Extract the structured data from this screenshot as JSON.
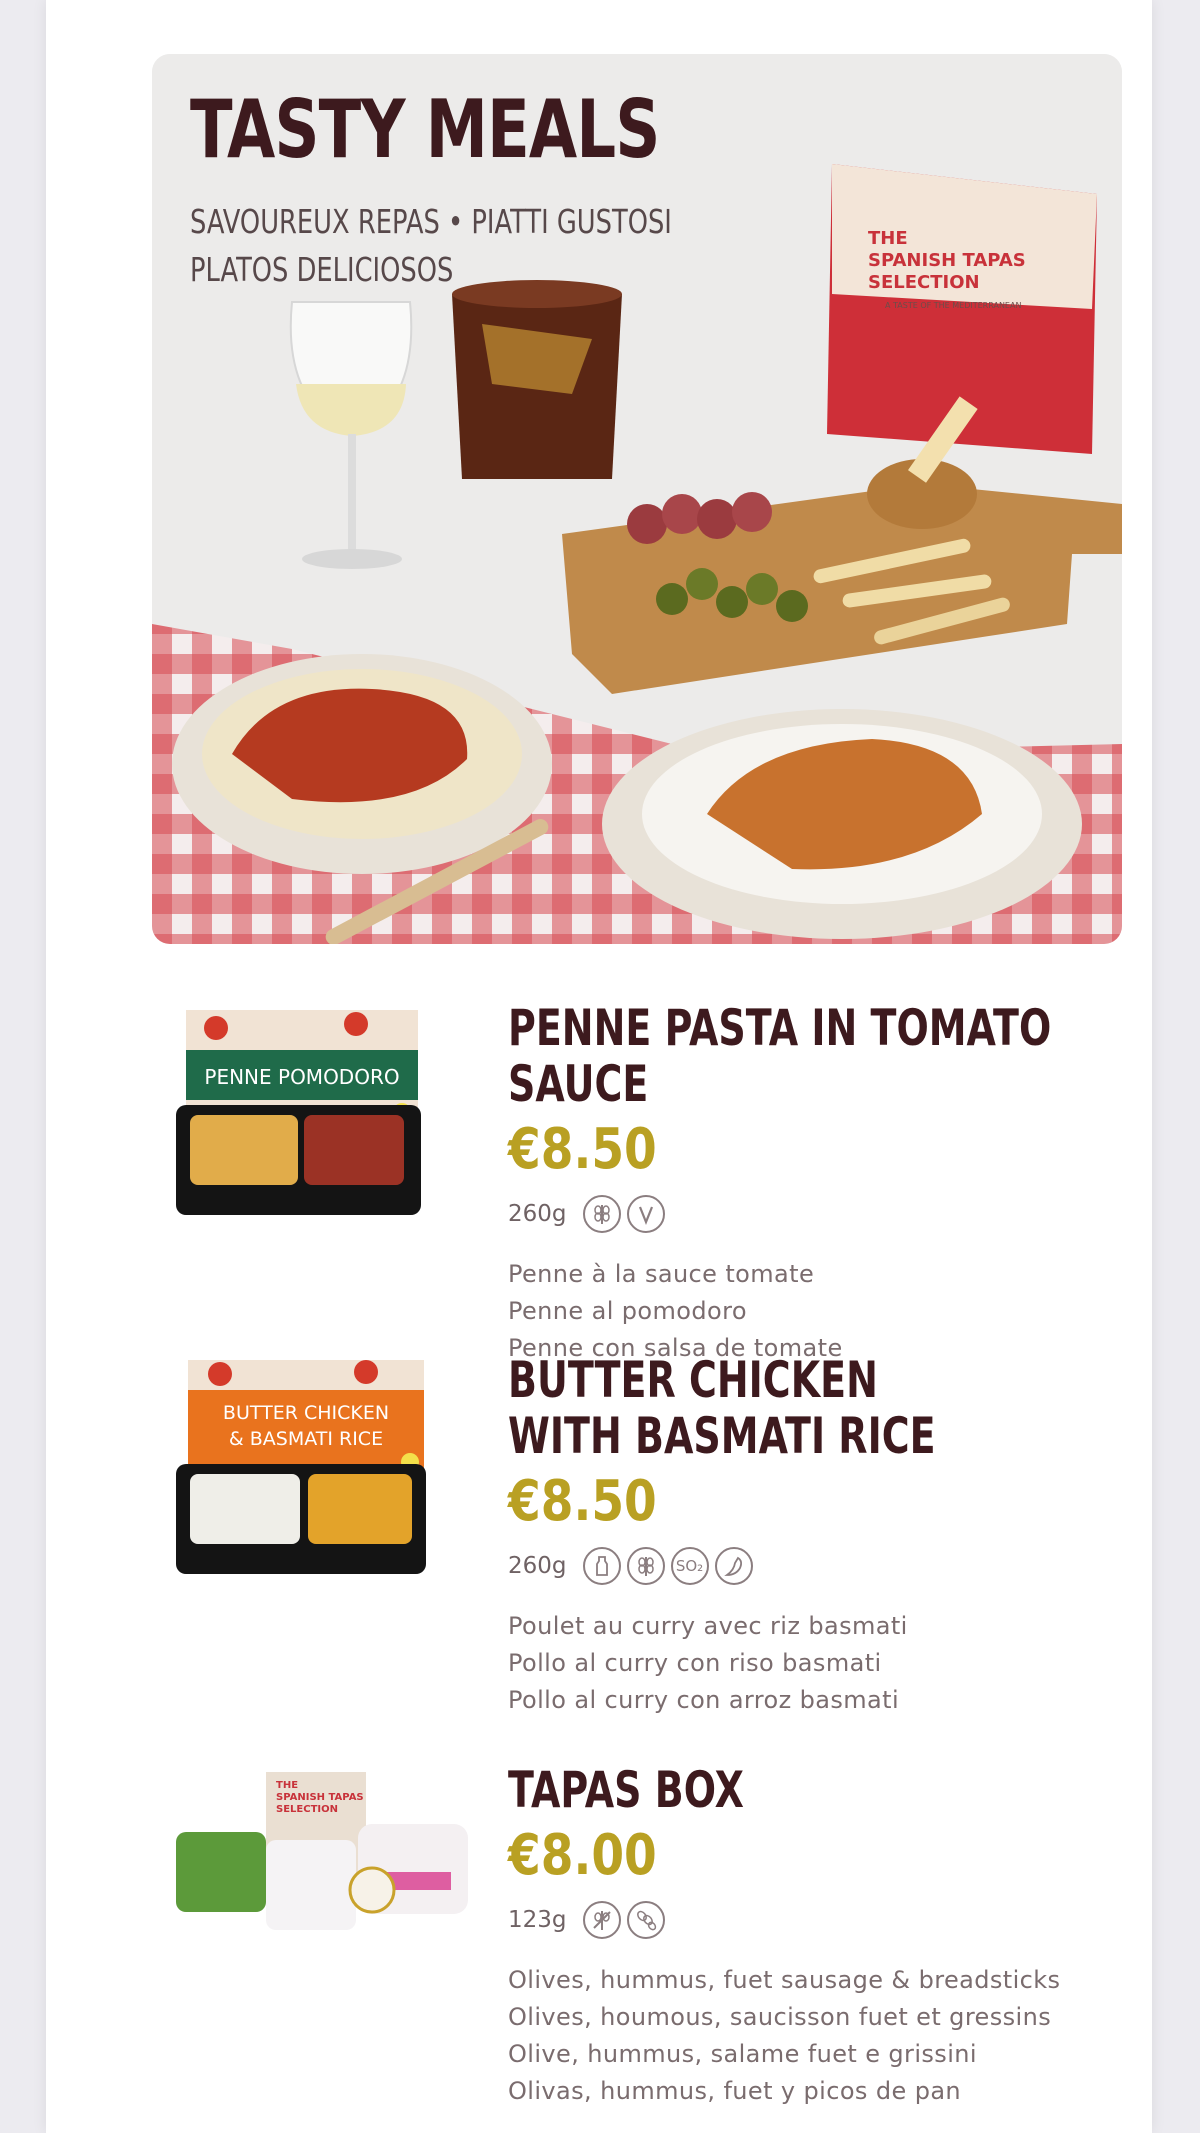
{
  "hero": {
    "title": "TASTY MEALS",
    "subtitle_line1": "SAVOUREUX REPAS • PIATTI GUSTOSI",
    "subtitle_line2": "PLATOS DELICIOSOS",
    "box_text": {
      "line1": "THE",
      "line2": "SPANISH TAPAS",
      "line3": "SELECTION",
      "tagline": "A TASTE OF THE MEDITERRANEAN"
    }
  },
  "products": [
    {
      "name_lines": [
        "PENNE PASTA IN TOMATO SAUCE"
      ],
      "price": "€8.50",
      "weight": "260g",
      "allergen_icons": [
        "gluten-icon",
        "vegetarian-icon"
      ],
      "package_label": "PENNE POMODORO",
      "descriptions": [
        "Penne à la sauce tomate",
        "Penne al pomodoro",
        "Penne con salsa de tomate"
      ]
    },
    {
      "name_lines": [
        "BUTTER CHICKEN",
        "WITH BASMATI RICE"
      ],
      "price": "€8.50",
      "weight": "260g",
      "allergen_icons": [
        "milk-icon",
        "gluten-icon",
        "sulphites-icon",
        "spicy-icon"
      ],
      "allergen_text": {
        "sulphites": "SO₂"
      },
      "package_label_line1": "BUTTER CHICKEN",
      "package_label_line2": "& BASMATI RICE",
      "descriptions": [
        "Poulet au curry avec riz basmati",
        "Pollo al curry con riso basmati",
        "Pollo al curry con arroz basmati"
      ]
    },
    {
      "name_lines": [
        "TAPAS BOX"
      ],
      "price": "€8.00",
      "weight": "123g",
      "allergen_icons": [
        "gluten-free-icon",
        "sesame-icon"
      ],
      "package_label_line1": "THE",
      "package_label_line2": "SPANISH TAPAS",
      "package_label_line3": "SELECTION",
      "descriptions": [
        "Olives, hummus, fuet sausage & breadsticks",
        "Olives, houmous, saucisson fuet et gressins",
        "Olive, hummus, salame fuet e grissini",
        "Olivas, hummus, fuet y picos de pan"
      ]
    }
  ],
  "colors": {
    "title": "#3d1a1e",
    "price": "#b9a023",
    "text_muted": "#7a6c6e",
    "page_bg": "#ecebf0"
  }
}
